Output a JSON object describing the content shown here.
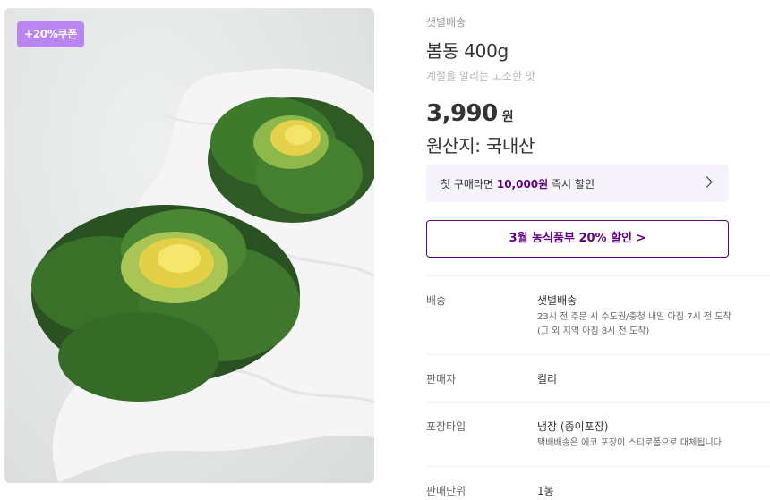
{
  "image": {
    "coupon_badge": "+20%쿠폰",
    "subject_icon": "napa-cabbage-icon"
  },
  "product": {
    "brand": "샛별배송",
    "title": "봄동 400g",
    "subtitle": "계절을 알리는 고소한 맛",
    "price": "3,990",
    "currency": "원",
    "origin": "원산지: 국내산"
  },
  "promo": {
    "first_purchase_prefix": "첫 구매라면 ",
    "first_purchase_amount": "10,000원",
    "first_purchase_suffix": " 즉시 할인",
    "event_button": "3월 농식품부 20% 할인 >"
  },
  "details": [
    {
      "label": "배송",
      "value": "샛별배송",
      "notes": [
        "23시 전 주문 시 수도권/충청 내일 아침 7시 전 도착",
        "(그 외 지역 아침 8시 전 도착)"
      ]
    },
    {
      "label": "판매자",
      "value": "컬리",
      "notes": []
    },
    {
      "label": "포장타입",
      "value": "냉장 (종이포장)",
      "notes": [
        "택배배송은 에코 포장이 스티로폼으로 대체됩니다."
      ]
    },
    {
      "label": "판매단위",
      "value": "1봉",
      "notes": []
    }
  ],
  "colors": {
    "accent": "#5f0080",
    "badge": "#b985f0",
    "promo_bg": "#f7f3fc"
  }
}
